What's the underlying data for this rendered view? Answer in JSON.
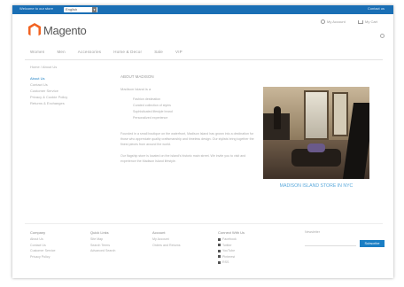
{
  "topbar": {
    "store_label": "Welcome to our store",
    "store_select": "English",
    "top_right": "Contact us"
  },
  "header": {
    "logo_text": "Magento",
    "account_label": "My Account",
    "cart_label": "My Cart"
  },
  "nav": {
    "items": [
      "Women",
      "Men",
      "Accessories",
      "Home & Decor",
      "Sale",
      "VIP"
    ]
  },
  "breadcrumb": "Home / About Us",
  "sidebar": {
    "items": [
      {
        "label": "About Us",
        "active": true
      },
      {
        "label": "Contact Us",
        "active": false
      },
      {
        "label": "Customer Service",
        "active": false
      },
      {
        "label": "Privacy & Cookie Policy",
        "active": false
      },
      {
        "label": "Returns & Exchanges",
        "active": false
      }
    ]
  },
  "content": {
    "title": "ABOUT MADISON",
    "intro": "Madison Island is a",
    "bullets": [
      "Fashion destination",
      "Curated collection of styles",
      "Sophisticated lifestyle brand",
      "Personalized experience"
    ],
    "paragraph1": "Founded in a small boutique on the waterfront, Madison Island has grown into a destination for those who appreciate quality craftsmanship and timeless design. Our stylists bring together the finest pieces from around the world.",
    "paragraph2": "Our flagship store is located on the island's historic main street. We invite you to visit and experience the Madison Island lifestyle."
  },
  "photo": {
    "caption": "MADISON ISLAND STORE IN NYC"
  },
  "footer": {
    "columns": [
      {
        "heading": "Company",
        "items": [
          "About Us",
          "Contact Us",
          "Customer Service",
          "Privacy Policy"
        ]
      },
      {
        "heading": "Quick Links",
        "items": [
          "Site Map",
          "Search Terms",
          "Advanced Search"
        ]
      },
      {
        "heading": "Account",
        "items": [
          "My Account",
          "Orders and Returns"
        ]
      },
      {
        "heading": "Connect With Us",
        "items": [
          "Facebook",
          "Twitter",
          "YouTube",
          "Pinterest",
          "RSS"
        ]
      }
    ],
    "newsletter_label": "Newsletter",
    "subscribe_label": "Subscribe"
  }
}
